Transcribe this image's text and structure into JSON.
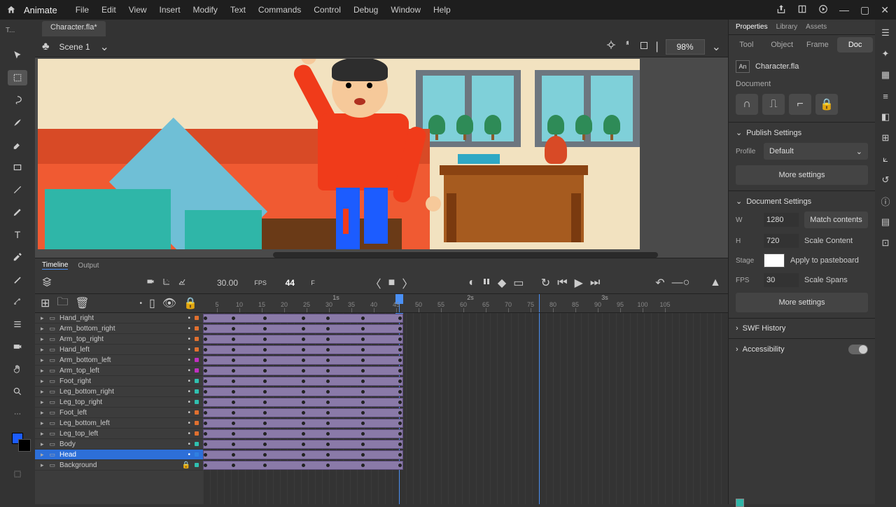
{
  "app": {
    "title": "Animate"
  },
  "menu": {
    "items": [
      "File",
      "Edit",
      "View",
      "Insert",
      "Modify",
      "Text",
      "Commands",
      "Control",
      "Debug",
      "Window",
      "Help"
    ]
  },
  "tab": {
    "label": "Character.fla*"
  },
  "scene": {
    "name": "Scene 1",
    "zoom": "98%"
  },
  "timeline": {
    "tabs": [
      "Timeline",
      "Output"
    ],
    "fps": "30.00",
    "fps_label": "FPS",
    "frame": "44",
    "frame_suffix": "F",
    "seconds": [
      "1s",
      "2s",
      "3s"
    ],
    "ticks": [
      "5",
      "10",
      "15",
      "20",
      "25",
      "30",
      "35",
      "40",
      "45",
      "50",
      "55",
      "60",
      "65",
      "70",
      "75",
      "80",
      "85",
      "90",
      "95",
      "100",
      "105"
    ]
  },
  "layers": [
    {
      "name": "Hand_right",
      "color": "#e07030"
    },
    {
      "name": "Arm_bottom_right",
      "color": "#e07030"
    },
    {
      "name": "Arm_top_right",
      "color": "#e07030"
    },
    {
      "name": "Hand_left",
      "color": "#e07030"
    },
    {
      "name": "Arm_bottom_left",
      "color": "#c030c0"
    },
    {
      "name": "Arm_top_left",
      "color": "#c030c0"
    },
    {
      "name": "Foot_right",
      "color": "#30c0b0"
    },
    {
      "name": "Leg_bottom_right",
      "color": "#30c0b0"
    },
    {
      "name": "Leg_top_right",
      "color": "#30c0b0"
    },
    {
      "name": "Foot_left",
      "color": "#e07030"
    },
    {
      "name": "Leg_bottom_left",
      "color": "#e07030"
    },
    {
      "name": "Leg_top_left",
      "color": "#e07030"
    },
    {
      "name": "Body",
      "color": "#30c0b0"
    },
    {
      "name": "Head",
      "color": "#3080e0",
      "selected": true
    },
    {
      "name": "Background",
      "color": "#30c0b0",
      "locked": true
    }
  ],
  "properties": {
    "tabs": [
      "Properties",
      "Library",
      "Assets"
    ],
    "modes": [
      "Tool",
      "Object",
      "Frame",
      "Doc"
    ],
    "active_mode": "Doc",
    "doc_name": "Character.fla",
    "doc_label": "Document",
    "publish": {
      "title": "Publish Settings",
      "profile_label": "Profile",
      "profile": "Default",
      "more": "More settings"
    },
    "docset": {
      "title": "Document Settings",
      "w_label": "W",
      "w": "1280",
      "h_label": "H",
      "h": "720",
      "stage_label": "Stage",
      "fps_label": "FPS",
      "fps": "30",
      "match": "Match contents",
      "scale_content": "Scale Content",
      "apply_paste": "Apply to pasteboard",
      "scale_spans": "Scale Spans",
      "more": "More settings"
    },
    "swf": "SWF History",
    "access": "Accessibility"
  },
  "safe_label": "T..."
}
